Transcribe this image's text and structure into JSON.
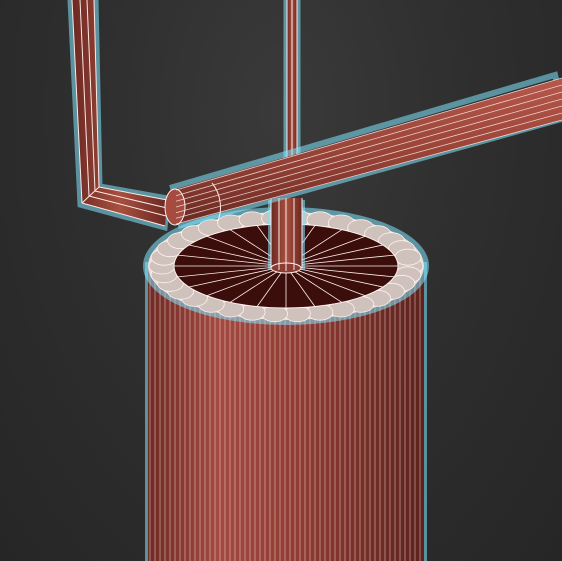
{
  "viewport": {
    "background": "#2d2d2d",
    "mode": "wireframe-on-shaded",
    "selection_outline_color": "#7fe6ff"
  },
  "objects": {
    "column": {
      "material_color": "#8f3b33",
      "cap_color": "#3b0d0b"
    },
    "pipe_horizontal": {
      "material_color": "#9a4438"
    },
    "pipe_bent": {
      "material_color": "#9a4438"
    },
    "rod_vertical": {
      "material_color": "#9a4438"
    },
    "spindle": {
      "material_color": "#8a3b33"
    }
  },
  "wire_color": "#fff1ee"
}
